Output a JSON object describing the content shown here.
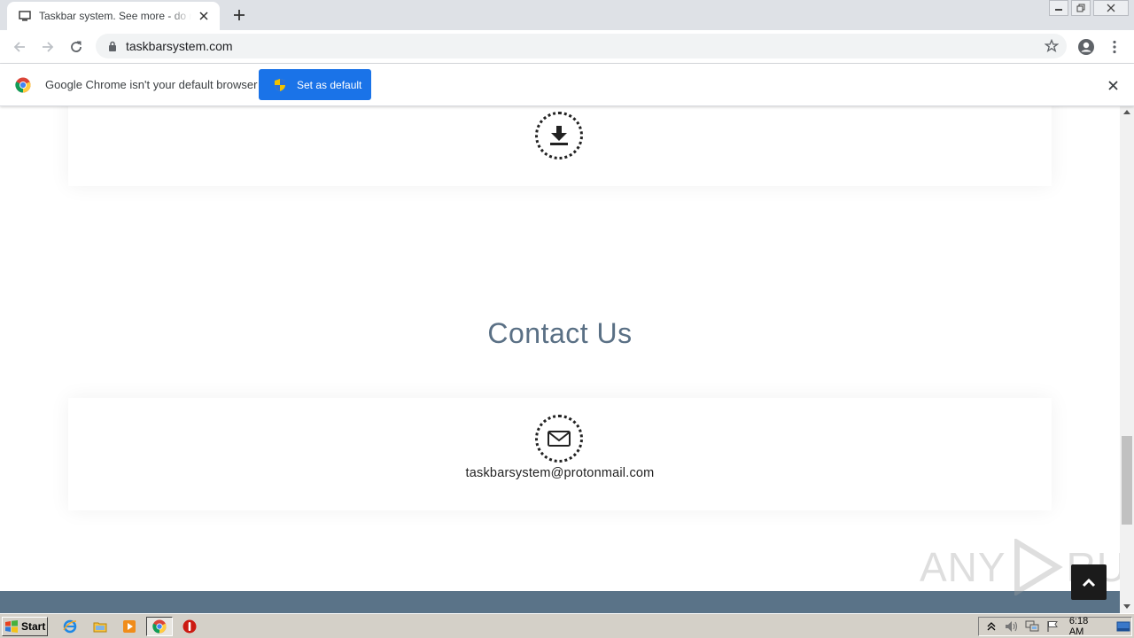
{
  "browser": {
    "tab_title": "Taskbar system. See more - do more with your taskbar",
    "url": "taskbarsystem.com"
  },
  "infobar": {
    "message": "Google Chrome isn't your default browser",
    "button_label": "Set as default"
  },
  "page": {
    "section_title": "Contact Us",
    "email": "taskbarsystem@protonmail.com",
    "watermark": {
      "left": "ANY",
      "right": "RUN"
    }
  },
  "taskbar": {
    "start_label": "Start",
    "clock": "6:18 AM"
  },
  "colors": {
    "accent": "#1a73e8",
    "heading": "#5a7085",
    "footer": "#5a7388"
  }
}
